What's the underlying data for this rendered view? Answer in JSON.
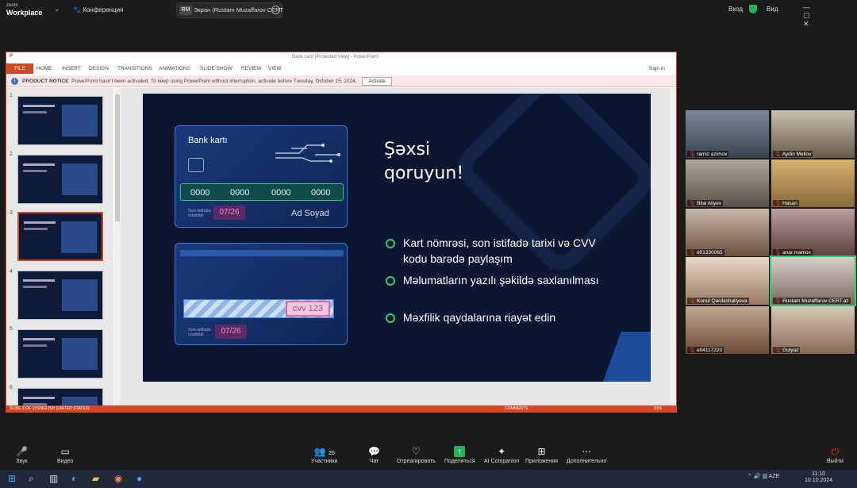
{
  "zoom": {
    "logo_line1": "zoom",
    "logo_line2": "Workplace",
    "conference_label": "Конференция",
    "share_avatar": "RM",
    "share_text": "Экран (Rustam Muzaffarov CERT",
    "login_label": "Вход",
    "view_label": "Вид",
    "window_controls": "— ▢ ✕"
  },
  "ppt": {
    "window_title": "Bank card [Protected View] - PowerPoint",
    "file_label": "FILE",
    "tabs": [
      "HOME",
      "INSERT",
      "DESIGN",
      "TRANSITIONS",
      "ANIMATIONS",
      "SLIDE SHOW",
      "REVIEW",
      "VIEW"
    ],
    "signin": "Sign in",
    "notice_bold": "PRODUCT NOTICE",
    "notice_text": "PowerPoint hasn't been activated. To keep using PowerPoint without interruption, activate before Tuesday, October 15, 2024.",
    "activate_label": "Activate",
    "thumb_numbers": [
      "1",
      "2",
      "3",
      "4",
      "5",
      "6"
    ],
    "status_left": "SLIDE 3 OF 12     ENGLISH (UNITED STATES)",
    "status_comments": "COMMENTS",
    "status_zoom": "91%"
  },
  "slide": {
    "card1_title": "Bank kartı",
    "card_numbers": [
      "0000",
      "0000",
      "0000",
      "0000"
    ],
    "expiry_label": "Son istifadə müddəti",
    "expiry": "07/26",
    "holder": "Ad Soyad",
    "cvv": "cvv 123",
    "title_line1": "Şəxsi",
    "title_line2": "qoruyun!",
    "bullets": [
      "Kart nömrəsi, son istifadə tarixi və CVV kodu barədə paylaşım",
      "Məlumatların yazılı şəkildə saxlanılması",
      "Məxfilik qaydalarına riayət edin"
    ]
  },
  "participants": [
    {
      "name": "ramiz azimov"
    },
    {
      "name": "Aydin Mellov"
    },
    {
      "name": "Bilal Aliyev"
    },
    {
      "name": "Hasan"
    },
    {
      "name": "e01330065"
    },
    {
      "name": "anar.mamox"
    },
    {
      "name": "Konul Qardashaliyeva"
    },
    {
      "name": "Rustam Muzaffarov CERT.az"
    },
    {
      "name": "e04117220"
    },
    {
      "name": "Gulyaz"
    }
  ],
  "toolbar": {
    "audio": "Звук",
    "video": "Видео",
    "participants": "Участники",
    "participants_count": "20",
    "chat": "Чат",
    "react": "Отреагировать",
    "share": "Поделиться",
    "ai": "AI Companion",
    "apps": "Приложения",
    "more": "Дополнительно",
    "leave": "Выйти"
  },
  "taskbar": {
    "lang": "AZE",
    "time": "11:10",
    "date": "10.10.2024"
  }
}
